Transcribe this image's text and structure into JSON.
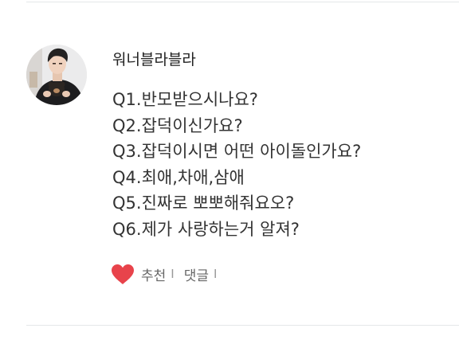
{
  "post": {
    "author": "워너블라블라",
    "questions": [
      "Q1.반모받으시나요?",
      "Q2.잡덕이신가요?",
      "Q3.잡덕이시면 어떤 아이돌인가요?",
      "Q4.최애,차애,삼애",
      "Q5.진짜로 뽀뽀해줘요오?",
      "Q6.제가 사랑하는거 알져?"
    ]
  },
  "actions": {
    "recommend_label": "추천",
    "comment_label": "댓글",
    "separator": "I"
  },
  "colors": {
    "heart": "#e8434b",
    "divider": "#e4e7e9",
    "text": "#333333",
    "muted": "#666666"
  },
  "icons": {
    "recommend": "heart-icon"
  }
}
